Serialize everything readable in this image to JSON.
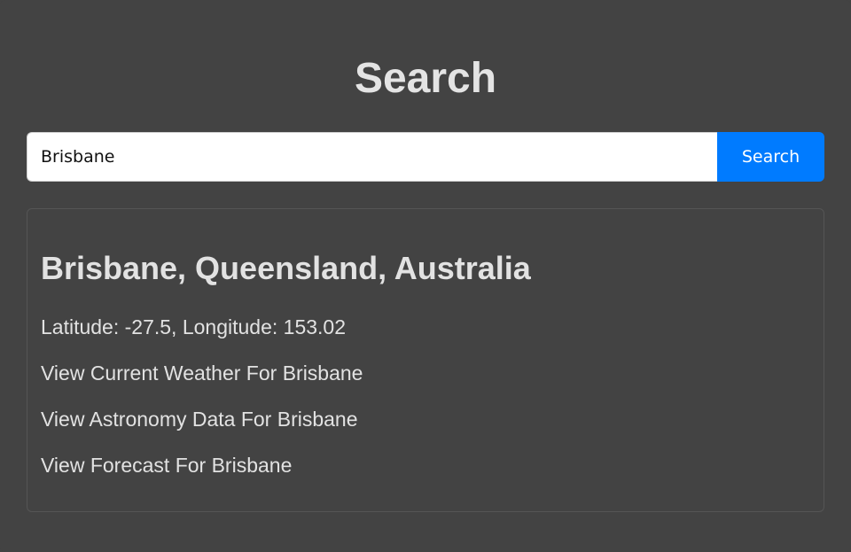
{
  "header": {
    "title": "Search"
  },
  "search": {
    "value": "Brisbane",
    "placeholder": "",
    "button_label": "Search",
    "button_color": "#007bff"
  },
  "result": {
    "title": "Brisbane, Queensland, Australia",
    "coordinates": "Latitude: -27.5, Longitude: 153.02",
    "links": {
      "current_weather": "View Current Weather For Brisbane",
      "astronomy": "View Astronomy Data For Brisbane",
      "forecast": "View Forecast For Brisbane"
    }
  },
  "colors": {
    "background": "#434343",
    "text": "#e2e2e2",
    "accent": "#007bff"
  }
}
